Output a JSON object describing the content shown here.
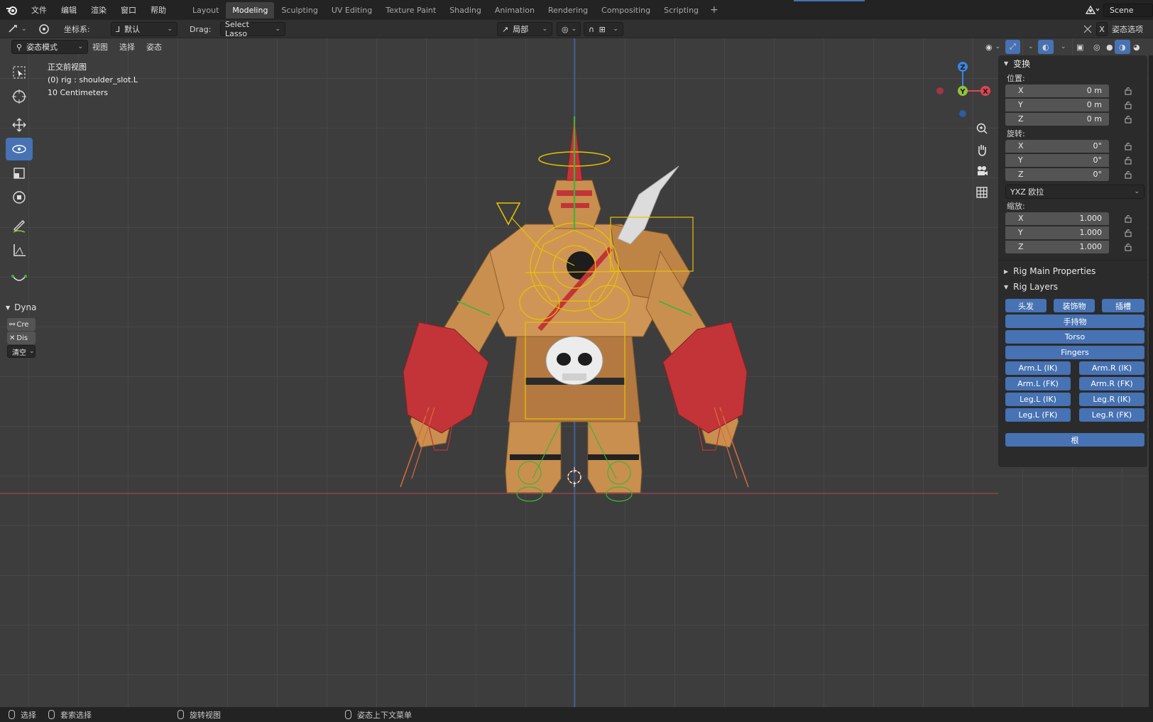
{
  "menu": {
    "items": [
      "文件",
      "编辑",
      "渲染",
      "窗口",
      "帮助"
    ]
  },
  "workspaces": {
    "tabs": [
      "Layout",
      "Modeling",
      "Sculpting",
      "UV Editing",
      "Texture Paint",
      "Shading",
      "Animation",
      "Rendering",
      "Compositing",
      "Scripting"
    ],
    "active": "Modeling",
    "add_label": "+"
  },
  "scene": {
    "label": "Scene"
  },
  "header": {
    "coord_label": "坐标系:",
    "coord_value": "默认",
    "drag_label": "Drag:",
    "drag_value": "Select Lasso",
    "pivot_value": "局部",
    "pose_options": "姿态选项",
    "x_toggle": "X"
  },
  "viewport_header": {
    "mode": "姿态模式",
    "menus": [
      "视图",
      "选择",
      "姿态"
    ]
  },
  "viewport_info": {
    "view_name": "正交前视图",
    "object": "(0) rig : shoulder_slot.L",
    "scale": "10 Centimeters"
  },
  "toolbar": {
    "tools": [
      "select-box",
      "cursor",
      "move",
      "rotate",
      "scale",
      "transform",
      "annotate",
      "measure",
      "bone-envelope"
    ],
    "active_tool": "rotate"
  },
  "dyna": {
    "title": "Dyna",
    "buttons": [
      "Cre",
      "Dis",
      "清空"
    ]
  },
  "gizmo": {
    "axes": {
      "z": "Z",
      "y": "Y",
      "x": "X"
    },
    "colors": {
      "x": "#e04552",
      "y": "#8fc33a",
      "z": "#3a84e4"
    }
  },
  "npanel": {
    "transform": {
      "title": "变换",
      "location_label": "位置:",
      "location": [
        {
          "axis": "X",
          "value": "0 m"
        },
        {
          "axis": "Y",
          "value": "0 m"
        },
        {
          "axis": "Z",
          "value": "0 m"
        }
      ],
      "rotation_label": "旋转:",
      "rotation": [
        {
          "axis": "X",
          "value": "0°"
        },
        {
          "axis": "Y",
          "value": "0°"
        },
        {
          "axis": "Z",
          "value": "0°"
        }
      ],
      "rotation_mode": "YXZ 欧拉",
      "scale_label": "缩放:",
      "scale": [
        {
          "axis": "X",
          "value": "1.000"
        },
        {
          "axis": "Y",
          "value": "1.000"
        },
        {
          "axis": "Z",
          "value": "1.000"
        }
      ]
    },
    "rig_main": {
      "title": "Rig Main Properties"
    },
    "rig_layers": {
      "title": "Rig Layers",
      "row1": [
        "头发",
        "装饰物",
        "插槽"
      ],
      "hand": "手持物",
      "torso": "Torso",
      "fingers": "Fingers",
      "arm_ik": [
        "Arm.L (IK)",
        "Arm.R (IK)"
      ],
      "arm_fk": [
        "Arm.L (FK)",
        "Arm.R (FK)"
      ],
      "leg_ik": [
        "Leg.L (IK)",
        "Leg.R (IK)"
      ],
      "leg_fk": [
        "Leg.L (FK)",
        "Leg.R (FK)"
      ],
      "root": "根"
    }
  },
  "status": {
    "select": "选择",
    "lasso": "套索选择",
    "rotate_view": "旋转视图",
    "context_menu": "姿态上下文菜单"
  },
  "colors": {
    "accent": "#4772b3",
    "bone_yellow": "#e6c400",
    "bone_green": "#3fb339",
    "body_tan": "#c78d4e",
    "body_red": "#c8343a"
  }
}
